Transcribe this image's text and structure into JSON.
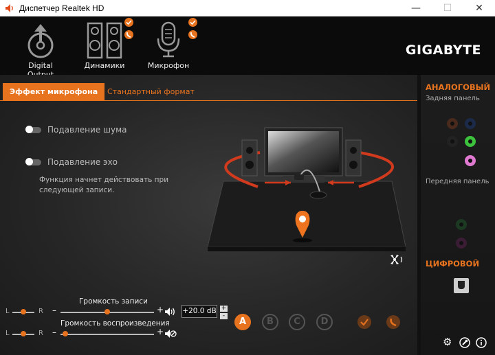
{
  "window": {
    "title": "Диспетчер Realtek HD",
    "minimize": "—",
    "maximize": "☐",
    "close": "✕"
  },
  "devices": [
    {
      "label": "Digital Output",
      "icon": "digital-output-icon"
    },
    {
      "label": "Динамики",
      "icon": "speakers-icon"
    },
    {
      "label": "Микрофон",
      "icon": "microphone-icon"
    }
  ],
  "brand": "GIGABYTE",
  "tabs": {
    "active": "Эффект микрофона",
    "other": "Стандартный формат"
  },
  "effects": {
    "noise_suppression": "Подавление шума",
    "echo_suppression": "Подавление эхо",
    "note": "Функция начнет действовать при следующей записи."
  },
  "volume": {
    "record_title": "Громкость записи",
    "playback_title": "Громкость воспроизведения",
    "left": "L",
    "right": "R",
    "plus": "+",
    "minus": "–",
    "db_value": "+20.0 dB",
    "step_up": "+",
    "step_down": "-",
    "record_level": 0.5,
    "playback_level": 0.05
  },
  "modes": [
    "A",
    "B",
    "C",
    "D"
  ],
  "side": {
    "analog": "АНАЛОГОВЫЙ",
    "rear": "Задняя панель",
    "front": "Передняя панель",
    "digital": "ЦИФРОВОЙ"
  },
  "colors": {
    "accent": "#e8731f",
    "background": "#262626"
  }
}
